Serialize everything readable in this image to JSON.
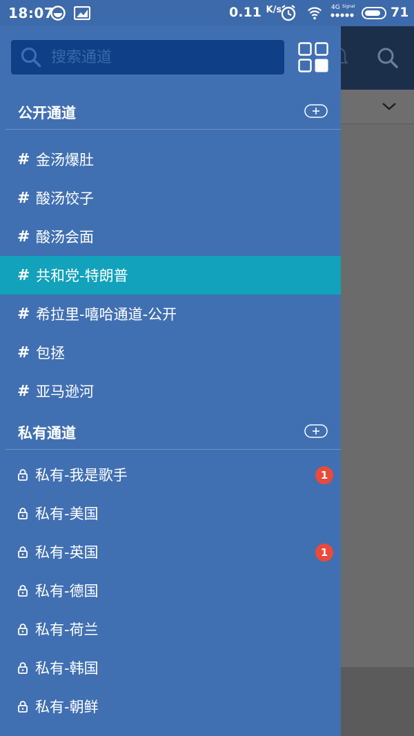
{
  "status_bar": {
    "time": "18:07",
    "speed": "0.11",
    "speed_unit": "K/s",
    "network": "4G",
    "signal_label": "Signal",
    "battery": "71"
  },
  "search": {
    "placeholder": "搜索通道"
  },
  "public_section": {
    "title": "公开通道",
    "channels": [
      {
        "label": "金汤爆肚"
      },
      {
        "label": "酸汤饺子"
      },
      {
        "label": "酸汤会面"
      },
      {
        "label": "共和党-特朗普",
        "active": true
      },
      {
        "label": "希拉里-嘻哈通道-公开"
      },
      {
        "label": "包拯"
      },
      {
        "label": "亚马逊河"
      }
    ]
  },
  "private_section": {
    "title": "私有通道",
    "channels": [
      {
        "label": "私有-我是歌手",
        "badge": "1"
      },
      {
        "label": "私有-美国"
      },
      {
        "label": "私有-英国",
        "badge": "1"
      },
      {
        "label": "私有-德国"
      },
      {
        "label": "私有-荷兰"
      },
      {
        "label": "私有-韩国"
      },
      {
        "label": "私有-朝鲜"
      }
    ]
  },
  "colors": {
    "drawer_bg": "#4170b2",
    "active_row": "#12a2bb",
    "search_bg": "#0f3f86",
    "badge": "#ea4a3b",
    "status_bar": "#3d6aaa"
  },
  "icons": [
    "search-icon",
    "grid-icon",
    "add-icon",
    "lock-icon",
    "bell-icon",
    "chevron-down-icon"
  ]
}
